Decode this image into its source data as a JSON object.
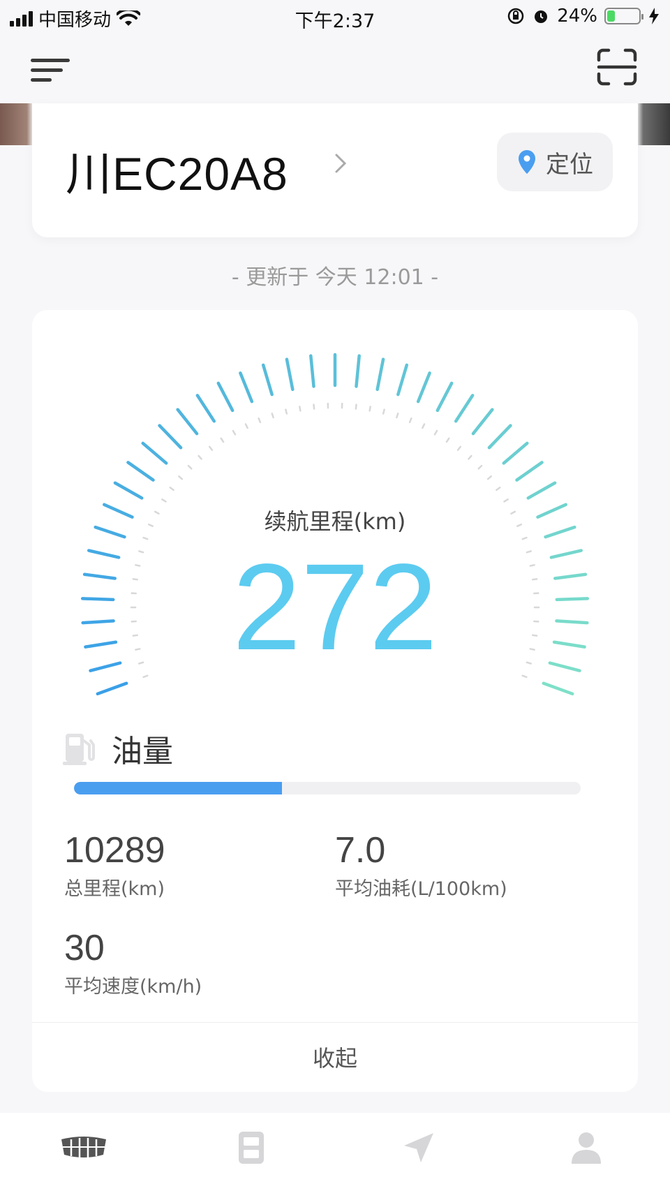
{
  "status_bar": {
    "carrier": "中国移动",
    "time": "下午2:37",
    "battery": "24%",
    "battery_level": 0.24
  },
  "vehicle": {
    "plate": "川EC20A8",
    "locate_label": "定位"
  },
  "update_time": "- 更新于 今天 12:01 -",
  "range": {
    "label": "续航里程(km)",
    "value": "272"
  },
  "fuel": {
    "title": "油量",
    "level": 0.41
  },
  "stats": [
    {
      "value": "10289",
      "label": "总里程(km)"
    },
    {
      "value": "7.0",
      "label": "平均油耗(L/100km)"
    },
    {
      "value": "30",
      "label": "平均速度(km/h)"
    }
  ],
  "collapse_label": "收起",
  "colors": {
    "accent": "#5ccbf0",
    "fuel": "#4a9ef0",
    "gauge_start": "#3aa0e8",
    "gauge_end": "#7ee0c8"
  },
  "tabs": [
    {
      "name": "tab-home",
      "icon": "car-grille-icon"
    },
    {
      "name": "tab-device",
      "icon": "remote-key-icon"
    },
    {
      "name": "tab-navigate",
      "icon": "navigation-arrow-icon"
    },
    {
      "name": "tab-profile",
      "icon": "person-icon"
    }
  ]
}
